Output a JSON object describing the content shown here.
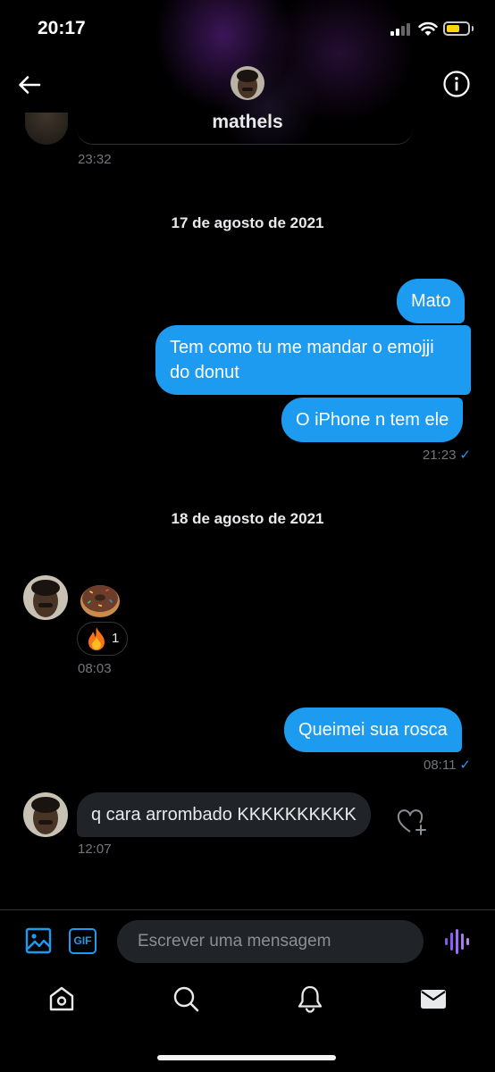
{
  "status_bar": {
    "time": "20:17"
  },
  "header": {
    "username": "mathels"
  },
  "top_timestamp": "23:32",
  "dates": {
    "first": "17 de agosto de 2021",
    "second": "18 de agosto de 2021"
  },
  "outgoing_group_1": {
    "messages": [
      "Mato",
      "Tem como tu me mandar o emojji do donut",
      "O iPhone n tem ele"
    ],
    "time": "21:23"
  },
  "incoming_donut": {
    "emoji": "donut",
    "reaction": {
      "emoji": "fire",
      "count": "1"
    },
    "time": "08:03"
  },
  "outgoing_2": {
    "text": "Queimei sua rosca",
    "time": "08:11"
  },
  "incoming_2": {
    "text": "q cara arrombado KKKKKKKKKK",
    "time": "12:07"
  },
  "composer": {
    "placeholder": "Escrever uma mensagem",
    "gif_label": "GIF"
  },
  "icons": {
    "back": "arrow-left-icon",
    "info": "info-icon",
    "media": "image-icon",
    "gif": "gif-icon",
    "voice": "voice-wave-icon",
    "heart_plus": "heart-plus-icon",
    "nav": [
      "home-icon",
      "search-icon",
      "bell-icon",
      "mail-icon"
    ]
  },
  "colors": {
    "accent": "#1d9bf0",
    "incoming_bubble": "#202327",
    "voice": "#8b5cf6",
    "read_check": "#1d9bf0"
  }
}
